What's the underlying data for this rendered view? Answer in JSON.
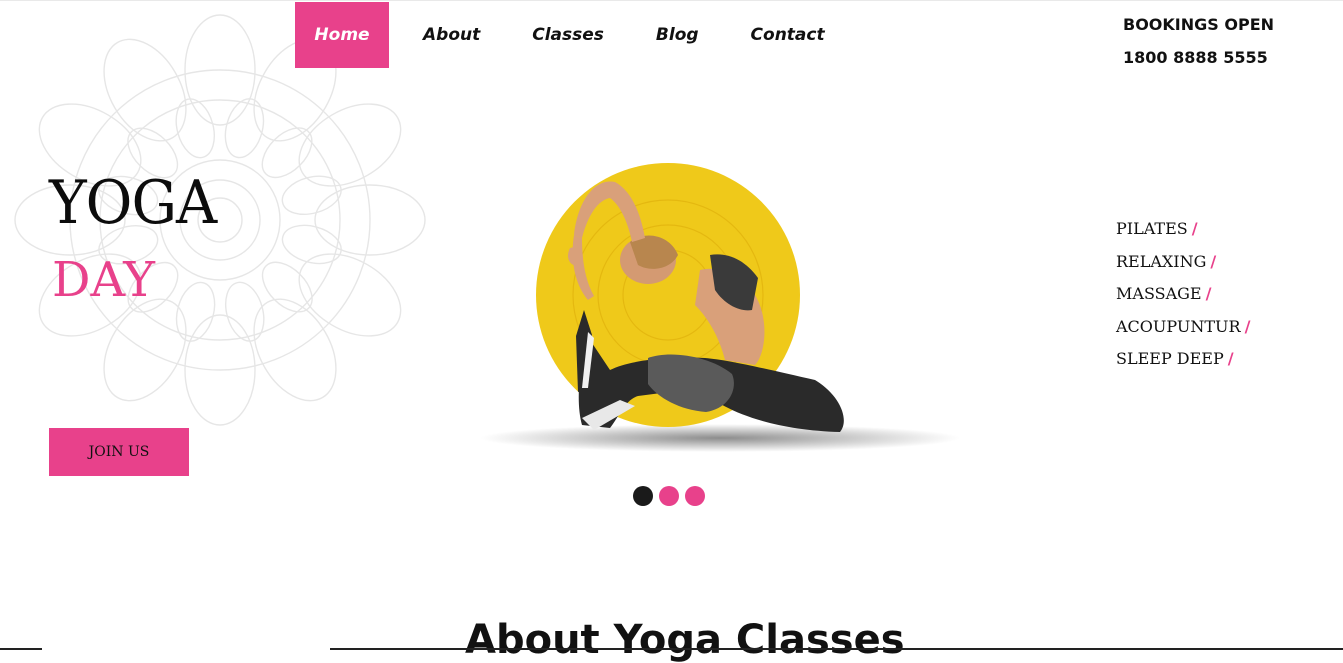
{
  "nav": {
    "items": [
      "Home",
      "About",
      "Classes",
      "Blog",
      "Contact"
    ],
    "active": "Home"
  },
  "bookings": {
    "label": "BOOKINGS OPEN",
    "phone": "1800 8888 5555"
  },
  "hero": {
    "title_line1": "YOGA",
    "title_line2": "DAY",
    "cta_label": "JOIN US"
  },
  "services": [
    "PILATES",
    "RELAXING",
    "MASSAGE",
    "ACOUPUNTUR",
    "SLEEP DEEP"
  ],
  "services_separator": "/",
  "slider": {
    "dots": 3,
    "active_index": 0
  },
  "section": {
    "about_title": "About Yoga Classes"
  },
  "colors": {
    "accent": "#e8418b",
    "sun": "#f1cd1c",
    "text": "#111111"
  }
}
